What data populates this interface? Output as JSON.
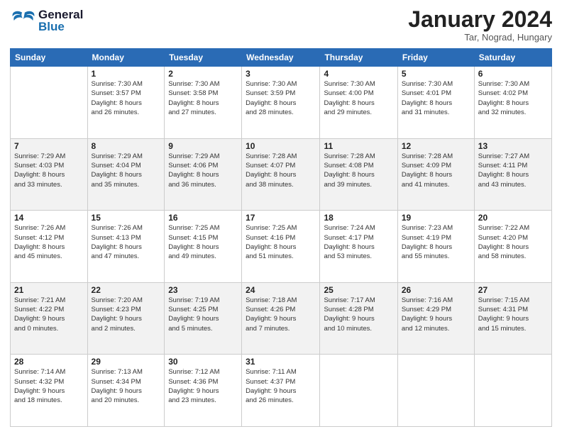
{
  "header": {
    "logo_general": "General",
    "logo_blue": "Blue",
    "month_year": "January 2024",
    "location": "Tar, Nograd, Hungary"
  },
  "columns": [
    "Sunday",
    "Monday",
    "Tuesday",
    "Wednesday",
    "Thursday",
    "Friday",
    "Saturday"
  ],
  "weeks": [
    [
      {
        "day": "",
        "info": ""
      },
      {
        "day": "1",
        "info": "Sunrise: 7:30 AM\nSunset: 3:57 PM\nDaylight: 8 hours\nand 26 minutes."
      },
      {
        "day": "2",
        "info": "Sunrise: 7:30 AM\nSunset: 3:58 PM\nDaylight: 8 hours\nand 27 minutes."
      },
      {
        "day": "3",
        "info": "Sunrise: 7:30 AM\nSunset: 3:59 PM\nDaylight: 8 hours\nand 28 minutes."
      },
      {
        "day": "4",
        "info": "Sunrise: 7:30 AM\nSunset: 4:00 PM\nDaylight: 8 hours\nand 29 minutes."
      },
      {
        "day": "5",
        "info": "Sunrise: 7:30 AM\nSunset: 4:01 PM\nDaylight: 8 hours\nand 31 minutes."
      },
      {
        "day": "6",
        "info": "Sunrise: 7:30 AM\nSunset: 4:02 PM\nDaylight: 8 hours\nand 32 minutes."
      }
    ],
    [
      {
        "day": "7",
        "info": "Sunrise: 7:29 AM\nSunset: 4:03 PM\nDaylight: 8 hours\nand 33 minutes."
      },
      {
        "day": "8",
        "info": "Sunrise: 7:29 AM\nSunset: 4:04 PM\nDaylight: 8 hours\nand 35 minutes."
      },
      {
        "day": "9",
        "info": "Sunrise: 7:29 AM\nSunset: 4:06 PM\nDaylight: 8 hours\nand 36 minutes."
      },
      {
        "day": "10",
        "info": "Sunrise: 7:28 AM\nSunset: 4:07 PM\nDaylight: 8 hours\nand 38 minutes."
      },
      {
        "day": "11",
        "info": "Sunrise: 7:28 AM\nSunset: 4:08 PM\nDaylight: 8 hours\nand 39 minutes."
      },
      {
        "day": "12",
        "info": "Sunrise: 7:28 AM\nSunset: 4:09 PM\nDaylight: 8 hours\nand 41 minutes."
      },
      {
        "day": "13",
        "info": "Sunrise: 7:27 AM\nSunset: 4:11 PM\nDaylight: 8 hours\nand 43 minutes."
      }
    ],
    [
      {
        "day": "14",
        "info": "Sunrise: 7:26 AM\nSunset: 4:12 PM\nDaylight: 8 hours\nand 45 minutes."
      },
      {
        "day": "15",
        "info": "Sunrise: 7:26 AM\nSunset: 4:13 PM\nDaylight: 8 hours\nand 47 minutes."
      },
      {
        "day": "16",
        "info": "Sunrise: 7:25 AM\nSunset: 4:15 PM\nDaylight: 8 hours\nand 49 minutes."
      },
      {
        "day": "17",
        "info": "Sunrise: 7:25 AM\nSunset: 4:16 PM\nDaylight: 8 hours\nand 51 minutes."
      },
      {
        "day": "18",
        "info": "Sunrise: 7:24 AM\nSunset: 4:17 PM\nDaylight: 8 hours\nand 53 minutes."
      },
      {
        "day": "19",
        "info": "Sunrise: 7:23 AM\nSunset: 4:19 PM\nDaylight: 8 hours\nand 55 minutes."
      },
      {
        "day": "20",
        "info": "Sunrise: 7:22 AM\nSunset: 4:20 PM\nDaylight: 8 hours\nand 58 minutes."
      }
    ],
    [
      {
        "day": "21",
        "info": "Sunrise: 7:21 AM\nSunset: 4:22 PM\nDaylight: 9 hours\nand 0 minutes."
      },
      {
        "day": "22",
        "info": "Sunrise: 7:20 AM\nSunset: 4:23 PM\nDaylight: 9 hours\nand 2 minutes."
      },
      {
        "day": "23",
        "info": "Sunrise: 7:19 AM\nSunset: 4:25 PM\nDaylight: 9 hours\nand 5 minutes."
      },
      {
        "day": "24",
        "info": "Sunrise: 7:18 AM\nSunset: 4:26 PM\nDaylight: 9 hours\nand 7 minutes."
      },
      {
        "day": "25",
        "info": "Sunrise: 7:17 AM\nSunset: 4:28 PM\nDaylight: 9 hours\nand 10 minutes."
      },
      {
        "day": "26",
        "info": "Sunrise: 7:16 AM\nSunset: 4:29 PM\nDaylight: 9 hours\nand 12 minutes."
      },
      {
        "day": "27",
        "info": "Sunrise: 7:15 AM\nSunset: 4:31 PM\nDaylight: 9 hours\nand 15 minutes."
      }
    ],
    [
      {
        "day": "28",
        "info": "Sunrise: 7:14 AM\nSunset: 4:32 PM\nDaylight: 9 hours\nand 18 minutes."
      },
      {
        "day": "29",
        "info": "Sunrise: 7:13 AM\nSunset: 4:34 PM\nDaylight: 9 hours\nand 20 minutes."
      },
      {
        "day": "30",
        "info": "Sunrise: 7:12 AM\nSunset: 4:36 PM\nDaylight: 9 hours\nand 23 minutes."
      },
      {
        "day": "31",
        "info": "Sunrise: 7:11 AM\nSunset: 4:37 PM\nDaylight: 9 hours\nand 26 minutes."
      },
      {
        "day": "",
        "info": ""
      },
      {
        "day": "",
        "info": ""
      },
      {
        "day": "",
        "info": ""
      }
    ]
  ]
}
